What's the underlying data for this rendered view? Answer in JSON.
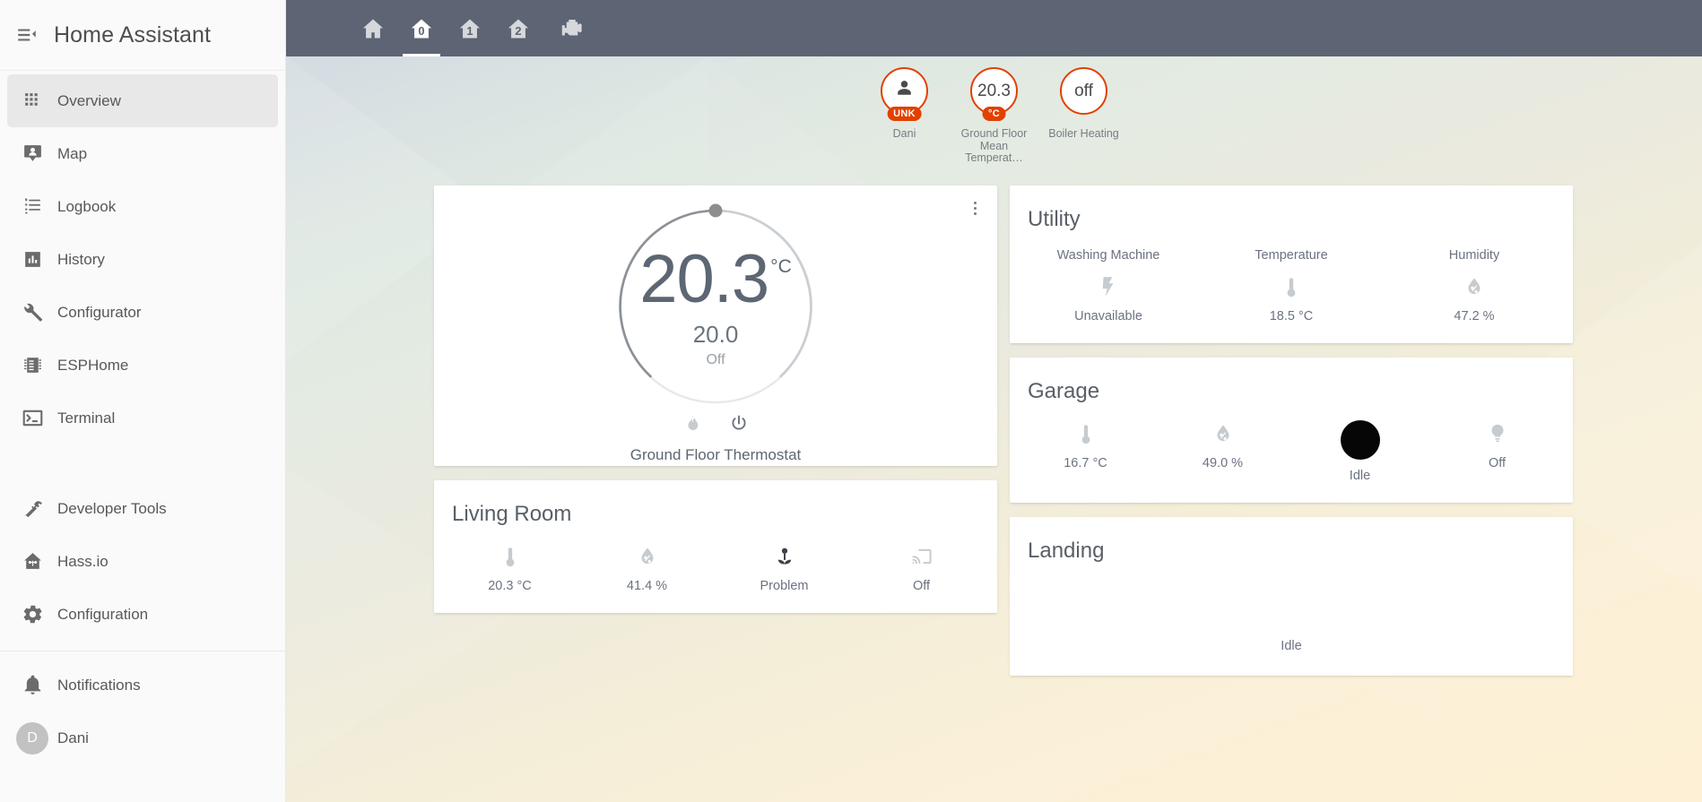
{
  "app": {
    "title": "Home Assistant",
    "menu_icon": "menu-open-icon"
  },
  "sidebar": {
    "items": [
      {
        "label": "Overview",
        "icon": "view-dashboard-icon",
        "active": true
      },
      {
        "label": "Map",
        "icon": "map-marker-account-icon",
        "active": false
      },
      {
        "label": "Logbook",
        "icon": "format-list-bulleted-icon",
        "active": false
      },
      {
        "label": "History",
        "icon": "chart-box-icon",
        "active": false
      },
      {
        "label": "Configurator",
        "icon": "wrench-icon",
        "active": false
      },
      {
        "label": "ESPHome",
        "icon": "chip-icon",
        "active": false
      },
      {
        "label": "Terminal",
        "icon": "console-icon",
        "active": false
      }
    ],
    "tools": [
      {
        "label": "Developer Tools",
        "icon": "hammer-icon"
      },
      {
        "label": "Hass.io",
        "icon": "home-assistant-icon"
      },
      {
        "label": "Configuration",
        "icon": "cog-icon"
      }
    ],
    "footer": [
      {
        "label": "Notifications",
        "icon": "bell-icon"
      }
    ],
    "user": {
      "label": "Dani",
      "initial": "D",
      "icon": "avatar"
    }
  },
  "toolbar": {
    "tabs": [
      {
        "icon": "home-icon",
        "label": "Home",
        "active": false
      },
      {
        "icon": "home-0-icon",
        "label": "0",
        "active": true
      },
      {
        "icon": "home-1-icon",
        "label": "1",
        "active": false
      },
      {
        "icon": "home-2-icon",
        "label": "2",
        "active": false
      },
      {
        "icon": "engine-icon",
        "label": "Engine",
        "active": false
      }
    ]
  },
  "badges": [
    {
      "name": "Dani",
      "value": "",
      "icon": "account-icon",
      "sub": "UNK",
      "accent": "#e24000"
    },
    {
      "name": "Ground Floor Mean Temperat…",
      "value": "20.3",
      "icon": "",
      "sub": "°C",
      "accent": "#e24000"
    },
    {
      "name": "Boiler Heating",
      "value": "off",
      "icon": "",
      "sub": "",
      "accent": "#e24000"
    }
  ],
  "thermostat": {
    "current_temperature": "20.3",
    "unit": "°C",
    "target_temperature": "20.0",
    "mode": "Off",
    "name": "Ground Floor Thermostat",
    "actions": [
      {
        "icon": "fire-icon",
        "name": "heat-mode-button",
        "active": false
      },
      {
        "icon": "power-icon",
        "name": "power-button",
        "active": true
      }
    ],
    "more_info": "more-info-button"
  },
  "cards": {
    "utility": {
      "title": "Utility",
      "entities": [
        {
          "name": "Washing Machine",
          "icon": "flash-icon",
          "state": "Unavailable"
        },
        {
          "name": "Temperature",
          "icon": "thermometer-icon",
          "state": "18.5 °C"
        },
        {
          "name": "Humidity",
          "icon": "water-percent-icon",
          "state": "47.2 %"
        }
      ]
    },
    "garage": {
      "title": "Garage",
      "entities": [
        {
          "name": "",
          "icon": "thermometer-icon",
          "state": "16.7 °C"
        },
        {
          "name": "",
          "icon": "water-percent-icon",
          "state": "49.0 %"
        },
        {
          "name": "",
          "icon": "vacuum-image",
          "state": "Idle"
        },
        {
          "name": "",
          "icon": "lightbulb-icon",
          "state": "Off"
        }
      ]
    },
    "landing": {
      "title": "Landing",
      "entities": [
        {
          "name": "",
          "icon": "",
          "state": "Idle"
        }
      ]
    },
    "living_room": {
      "title": "Living Room",
      "entities": [
        {
          "name": "",
          "icon": "thermometer-icon",
          "state": "20.3 °C"
        },
        {
          "name": "",
          "icon": "water-percent-icon",
          "state": "41.4 %"
        },
        {
          "name": "",
          "icon": "flower-icon",
          "state": "Problem"
        },
        {
          "name": "",
          "icon": "cast-icon",
          "state": "Off"
        }
      ]
    }
  },
  "colors": {
    "toolbar": "#5d6473",
    "accent": "#e24000",
    "text_primary": "#5d6673",
    "text_secondary": "#6b7280",
    "icon_inactive": "#c6cbcf",
    "icon_active": "#44739e",
    "sidebar_bg": "#fafafa",
    "card_bg": "#ffffff"
  }
}
